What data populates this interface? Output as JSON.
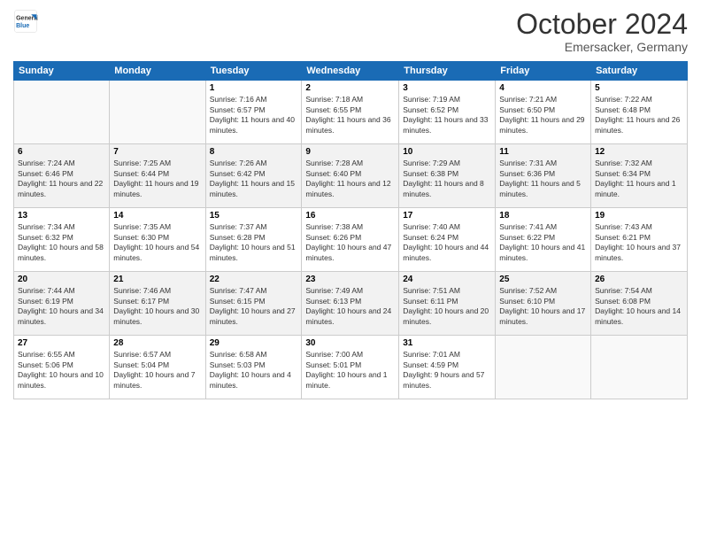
{
  "header": {
    "logo_line1": "General",
    "logo_line2": "Blue",
    "month": "October 2024",
    "location": "Emersacker, Germany"
  },
  "days_of_week": [
    "Sunday",
    "Monday",
    "Tuesday",
    "Wednesday",
    "Thursday",
    "Friday",
    "Saturday"
  ],
  "weeks": [
    [
      {
        "day": "",
        "info": ""
      },
      {
        "day": "",
        "info": ""
      },
      {
        "day": "1",
        "info": "Sunrise: 7:16 AM\nSunset: 6:57 PM\nDaylight: 11 hours and 40 minutes."
      },
      {
        "day": "2",
        "info": "Sunrise: 7:18 AM\nSunset: 6:55 PM\nDaylight: 11 hours and 36 minutes."
      },
      {
        "day": "3",
        "info": "Sunrise: 7:19 AM\nSunset: 6:52 PM\nDaylight: 11 hours and 33 minutes."
      },
      {
        "day": "4",
        "info": "Sunrise: 7:21 AM\nSunset: 6:50 PM\nDaylight: 11 hours and 29 minutes."
      },
      {
        "day": "5",
        "info": "Sunrise: 7:22 AM\nSunset: 6:48 PM\nDaylight: 11 hours and 26 minutes."
      }
    ],
    [
      {
        "day": "6",
        "info": "Sunrise: 7:24 AM\nSunset: 6:46 PM\nDaylight: 11 hours and 22 minutes."
      },
      {
        "day": "7",
        "info": "Sunrise: 7:25 AM\nSunset: 6:44 PM\nDaylight: 11 hours and 19 minutes."
      },
      {
        "day": "8",
        "info": "Sunrise: 7:26 AM\nSunset: 6:42 PM\nDaylight: 11 hours and 15 minutes."
      },
      {
        "day": "9",
        "info": "Sunrise: 7:28 AM\nSunset: 6:40 PM\nDaylight: 11 hours and 12 minutes."
      },
      {
        "day": "10",
        "info": "Sunrise: 7:29 AM\nSunset: 6:38 PM\nDaylight: 11 hours and 8 minutes."
      },
      {
        "day": "11",
        "info": "Sunrise: 7:31 AM\nSunset: 6:36 PM\nDaylight: 11 hours and 5 minutes."
      },
      {
        "day": "12",
        "info": "Sunrise: 7:32 AM\nSunset: 6:34 PM\nDaylight: 11 hours and 1 minute."
      }
    ],
    [
      {
        "day": "13",
        "info": "Sunrise: 7:34 AM\nSunset: 6:32 PM\nDaylight: 10 hours and 58 minutes."
      },
      {
        "day": "14",
        "info": "Sunrise: 7:35 AM\nSunset: 6:30 PM\nDaylight: 10 hours and 54 minutes."
      },
      {
        "day": "15",
        "info": "Sunrise: 7:37 AM\nSunset: 6:28 PM\nDaylight: 10 hours and 51 minutes."
      },
      {
        "day": "16",
        "info": "Sunrise: 7:38 AM\nSunset: 6:26 PM\nDaylight: 10 hours and 47 minutes."
      },
      {
        "day": "17",
        "info": "Sunrise: 7:40 AM\nSunset: 6:24 PM\nDaylight: 10 hours and 44 minutes."
      },
      {
        "day": "18",
        "info": "Sunrise: 7:41 AM\nSunset: 6:22 PM\nDaylight: 10 hours and 41 minutes."
      },
      {
        "day": "19",
        "info": "Sunrise: 7:43 AM\nSunset: 6:21 PM\nDaylight: 10 hours and 37 minutes."
      }
    ],
    [
      {
        "day": "20",
        "info": "Sunrise: 7:44 AM\nSunset: 6:19 PM\nDaylight: 10 hours and 34 minutes."
      },
      {
        "day": "21",
        "info": "Sunrise: 7:46 AM\nSunset: 6:17 PM\nDaylight: 10 hours and 30 minutes."
      },
      {
        "day": "22",
        "info": "Sunrise: 7:47 AM\nSunset: 6:15 PM\nDaylight: 10 hours and 27 minutes."
      },
      {
        "day": "23",
        "info": "Sunrise: 7:49 AM\nSunset: 6:13 PM\nDaylight: 10 hours and 24 minutes."
      },
      {
        "day": "24",
        "info": "Sunrise: 7:51 AM\nSunset: 6:11 PM\nDaylight: 10 hours and 20 minutes."
      },
      {
        "day": "25",
        "info": "Sunrise: 7:52 AM\nSunset: 6:10 PM\nDaylight: 10 hours and 17 minutes."
      },
      {
        "day": "26",
        "info": "Sunrise: 7:54 AM\nSunset: 6:08 PM\nDaylight: 10 hours and 14 minutes."
      }
    ],
    [
      {
        "day": "27",
        "info": "Sunrise: 6:55 AM\nSunset: 5:06 PM\nDaylight: 10 hours and 10 minutes."
      },
      {
        "day": "28",
        "info": "Sunrise: 6:57 AM\nSunset: 5:04 PM\nDaylight: 10 hours and 7 minutes."
      },
      {
        "day": "29",
        "info": "Sunrise: 6:58 AM\nSunset: 5:03 PM\nDaylight: 10 hours and 4 minutes."
      },
      {
        "day": "30",
        "info": "Sunrise: 7:00 AM\nSunset: 5:01 PM\nDaylight: 10 hours and 1 minute."
      },
      {
        "day": "31",
        "info": "Sunrise: 7:01 AM\nSunset: 4:59 PM\nDaylight: 9 hours and 57 minutes."
      },
      {
        "day": "",
        "info": ""
      },
      {
        "day": "",
        "info": ""
      }
    ]
  ]
}
